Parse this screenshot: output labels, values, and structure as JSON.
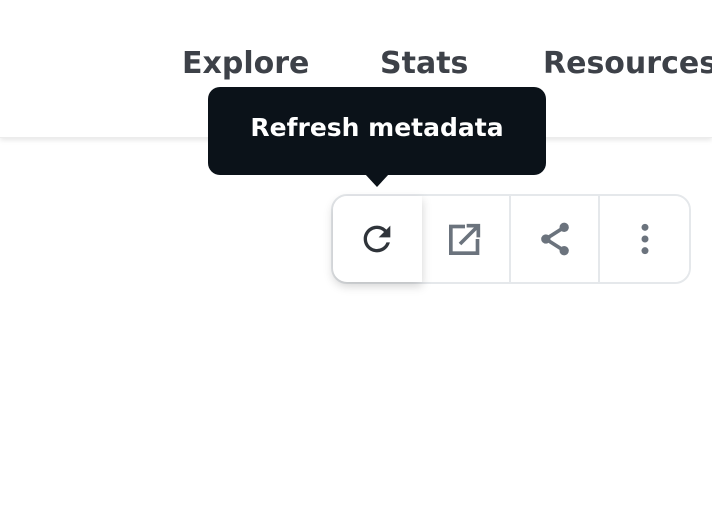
{
  "nav": {
    "items": [
      {
        "label": "Explore"
      },
      {
        "label": "Stats"
      },
      {
        "label": "Resources"
      }
    ]
  },
  "tooltip": {
    "text": "Refresh metadata"
  },
  "toolbar": {
    "buttons": [
      {
        "icon": "refresh-icon",
        "active": true
      },
      {
        "icon": "open-external-icon",
        "active": false
      },
      {
        "icon": "share-icon",
        "active": false
      },
      {
        "icon": "more-vertical-icon",
        "active": false
      }
    ]
  },
  "colors": {
    "nav_text": "#3d4148",
    "tooltip_bg": "#0b1219",
    "tooltip_text": "#ffffff",
    "icon_active": "#2f343a",
    "icon_default": "#6b737d",
    "border": "#e5e8eb"
  }
}
